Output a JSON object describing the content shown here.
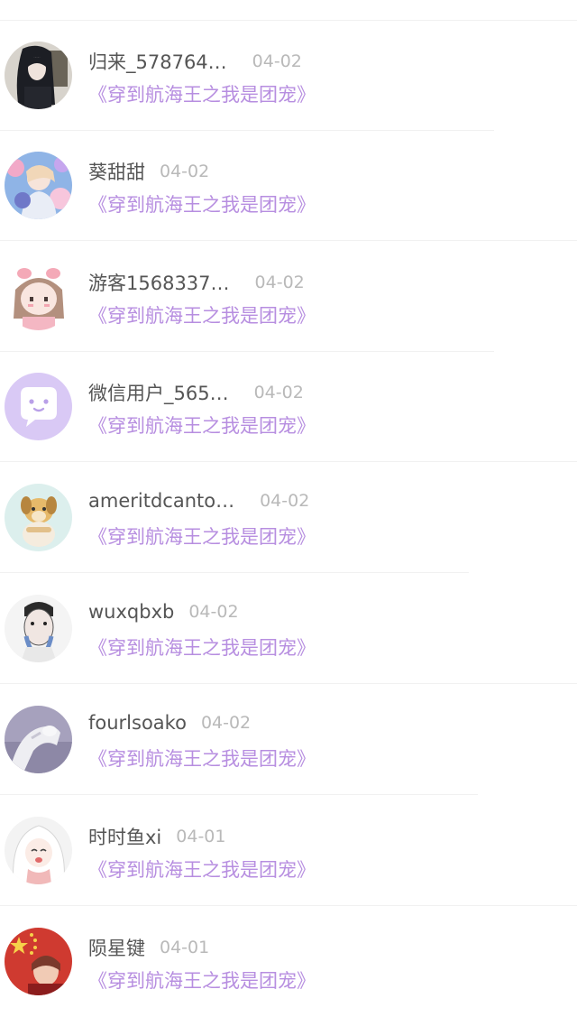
{
  "comments": [
    {
      "username": "归来_578764…",
      "date": "04-02",
      "book": "《穿到航海王之我是团宠》",
      "avatar_icon": "dark-haired-girl-avatar-icon",
      "avatar_color": "#3a3f4a"
    },
    {
      "username": "葵甜甜",
      "date": "04-02",
      "book": "《穿到航海王之我是团宠》",
      "avatar_icon": "cosplay-girl-avatar-icon",
      "avatar_color": "#c9b7e6"
    },
    {
      "username": "游客1568337…",
      "date": "04-02",
      "book": "《穿到航海王之我是团宠》",
      "avatar_icon": "pink-anime-girl-avatar-icon",
      "avatar_color": "#f6d9de"
    },
    {
      "username": "微信用户_565…",
      "date": "04-02",
      "book": "《穿到航海王之我是团宠》",
      "avatar_icon": "chat-bubble-avatar-icon",
      "avatar_color": "#d8c8f4"
    },
    {
      "username": "ameritdcanto…",
      "date": "04-02",
      "book": "《穿到航海王之我是团宠》",
      "avatar_icon": "puppy-avatar-icon",
      "avatar_color": "#dff0ee"
    },
    {
      "username": "wuxqbxb",
      "date": "04-02",
      "book": "《穿到航海王之我是团宠》",
      "avatar_icon": "sketched-face-avatar-icon",
      "avatar_color": "#e8e8e8"
    },
    {
      "username": "fourlsoako",
      "date": "04-02",
      "book": "《穿到航海王之我是团宠》",
      "avatar_icon": "sculpture-hand-avatar-icon",
      "avatar_color": "#9e98b4"
    },
    {
      "username": "时时鱼xi",
      "date": "04-01",
      "book": "《穿到航海王之我是团宠》",
      "avatar_icon": "white-haired-anime-avatar-icon",
      "avatar_color": "#ececec"
    },
    {
      "username": "陨星键",
      "date": "04-01",
      "book": "《穿到航海王之我是团宠》",
      "avatar_icon": "flag-avatar-icon",
      "avatar_color": "#c8342c"
    }
  ]
}
